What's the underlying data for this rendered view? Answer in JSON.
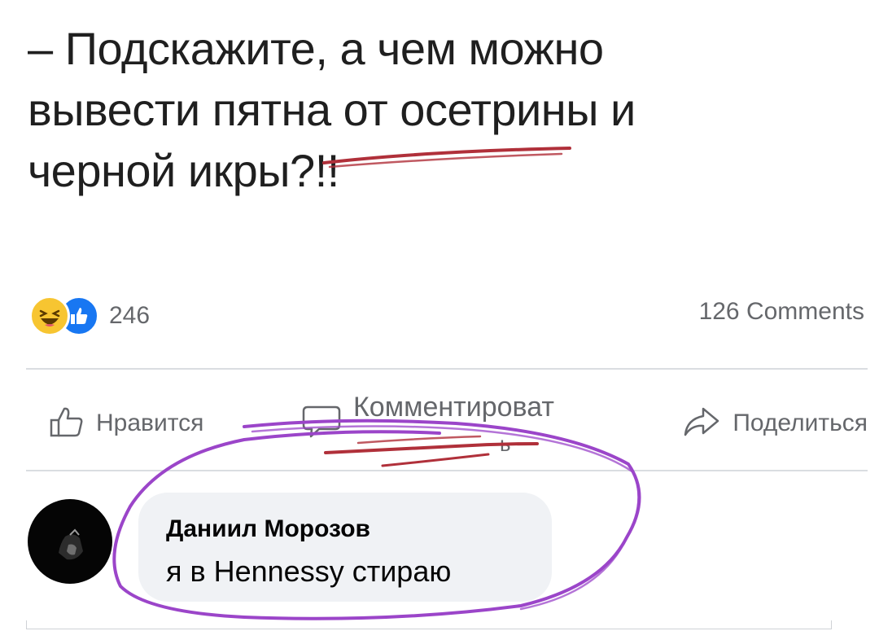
{
  "post": {
    "lines": [
      "– Подскажите, а чем можно",
      "вывести пятна от осетрины и",
      "черной икры?!!"
    ]
  },
  "reactions": {
    "icons": [
      "haha-emoji-icon",
      "like-thumb-icon"
    ],
    "count": "246",
    "comments_count": "126 Comments"
  },
  "actions": {
    "like_label": "Нравится",
    "comment_label": "Комментироват",
    "comment_label_overflow": "ь",
    "share_label": "Поделиться"
  },
  "comment": {
    "author": "Даниил Морозов",
    "text": "я в Hennessy стираю"
  },
  "colors": {
    "like_blue": "#1877f2",
    "haha_yellow": "#f7c531",
    "muted_text": "#65676b",
    "bubble_bg": "#f0f2f5",
    "marker_red": "#b0303a",
    "marker_purple": "#9b45c9"
  }
}
